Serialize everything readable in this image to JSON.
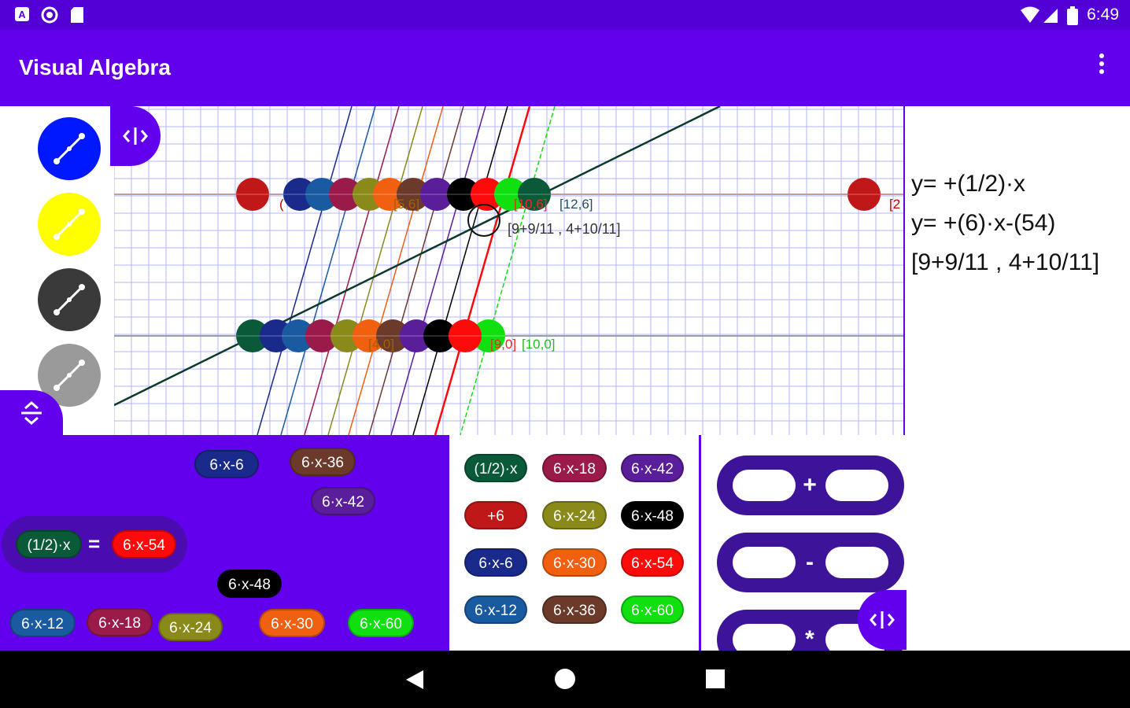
{
  "status_bar": {
    "time": "6:49",
    "left_icons": [
      "a-icon",
      "record-icon",
      "sdcard-icon"
    ],
    "right_icons": [
      "wifi-icon",
      "signal-icon",
      "battery-icon"
    ]
  },
  "app_bar": {
    "title": "Visual Algebra",
    "menu_icon": "more-vert-icon"
  },
  "left_panel": {
    "line_colors": [
      "#0018ff",
      "#ffff00",
      "#3a3a3a",
      "#9a9a9a"
    ]
  },
  "graph": {
    "point_labels": [
      {
        "text": "(",
        "color": "#c00000"
      },
      {
        "text": "[5,6]",
        "color": "#a06000"
      },
      {
        "text": "[10,6]",
        "color": "#ff2020"
      },
      {
        "text": "[12,6]",
        "color": "#205060"
      },
      {
        "text": "[9+9/11 , 4+10/11]",
        "color": "#333333"
      },
      {
        "text": "[2",
        "color": "#c00000"
      },
      {
        "text": "[4,0]",
        "color": "#a06000"
      },
      {
        "text": "[9,0]",
        "color": "#ff2020"
      },
      {
        "text": "[10,0]",
        "color": "#20c020"
      }
    ]
  },
  "equations": {
    "line1": "y= +(1/2)·x",
    "line2": "y= +(6)·x-(54)",
    "solution": "[9+9/11 , 4+10/11]"
  },
  "workspace": {
    "equation": {
      "left": "(1/2)·x",
      "sign": "=",
      "right": "6·x-54"
    },
    "loose_chips": [
      {
        "label": "6·x-6",
        "color": "#1a2a8a"
      },
      {
        "label": "6·x-36",
        "color": "#6b3a2a"
      },
      {
        "label": "6·x-42",
        "color": "#5a1e9a"
      },
      {
        "label": "6·x-48",
        "color": "#000000"
      },
      {
        "label": "6·x-12",
        "color": "#1a5aa0"
      },
      {
        "label": "6·x-18",
        "color": "#9a1a4a"
      },
      {
        "label": "6·x-24",
        "color": "#8a8a1a"
      },
      {
        "label": "6·x-30",
        "color": "#f06010"
      },
      {
        "label": "6·x-60",
        "color": "#10e010"
      }
    ]
  },
  "palette": {
    "chips": [
      {
        "label": "(1/2)·x",
        "color": "#0a5a3a"
      },
      {
        "label": "6·x-18",
        "color": "#9a1a4a"
      },
      {
        "label": "6·x-42",
        "color": "#5a1e9a"
      },
      {
        "label": "+6",
        "color": "#c01818"
      },
      {
        "label": "6·x-24",
        "color": "#8a8a1a"
      },
      {
        "label": "6·x-48",
        "color": "#000000"
      },
      {
        "label": "6·x-6",
        "color": "#1a2a8a"
      },
      {
        "label": "6·x-30",
        "color": "#f06010"
      },
      {
        "label": "6·x-54",
        "color": "#ff0a0a"
      },
      {
        "label": "6·x-12",
        "color": "#1a5aa0"
      },
      {
        "label": "6·x-36",
        "color": "#6b3a2a"
      },
      {
        "label": "6·x-60",
        "color": "#10e010"
      }
    ]
  },
  "operators": {
    "plus": "+",
    "minus": "-",
    "times": "*"
  },
  "nav_bar": {
    "back_icon": "back-triangle-icon",
    "home_icon": "home-circle-icon",
    "recents_icon": "recents-square-icon"
  }
}
